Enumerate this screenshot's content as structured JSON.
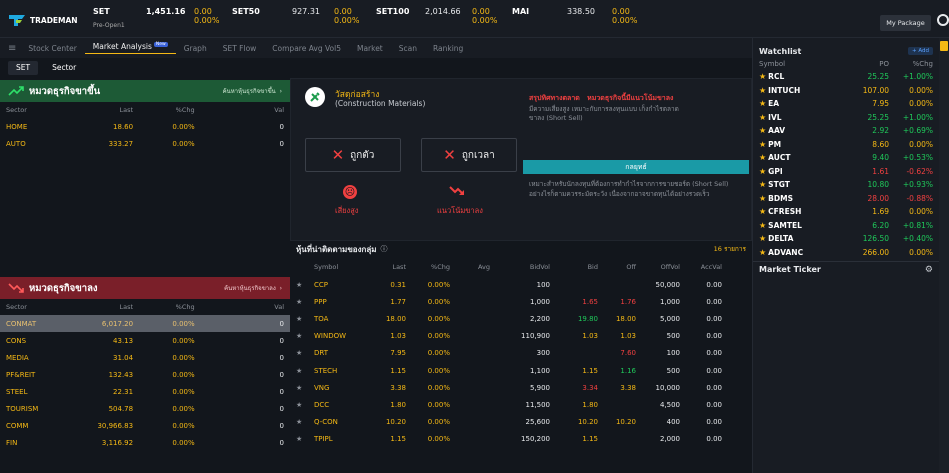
{
  "app": {
    "logo_text": "TRADEMAN",
    "my_package": "My Package"
  },
  "indices": [
    {
      "name": "SET",
      "value": "1,451.16",
      "chg": "0.00",
      "pct": "0.00%",
      "status": "Pre-Open1"
    },
    {
      "name": "SET50",
      "value": "927.31",
      "chg": "0.00",
      "pct": "0.00%"
    },
    {
      "name": "SET100",
      "value": "2,014.66",
      "chg": "0.00",
      "pct": "0.00%"
    },
    {
      "name": "MAI",
      "value": "338.50",
      "chg": "0.00",
      "pct": "0.00%"
    }
  ],
  "tabs": [
    "Stock Center",
    "Market Analysis",
    "Graph",
    "SET Flow",
    "Compare Avg Vol5",
    "Market",
    "Scan",
    "Ranking"
  ],
  "new_badge": "New",
  "subtabs": [
    "SET",
    "Sector"
  ],
  "up_panel": {
    "title": "หมวดธุรกิจขาขึ้น",
    "link": "ค้นหาหุ้นธุรกิจขาขึ้น",
    "headers": [
      "Sector",
      "Last",
      "%Chg",
      "Val"
    ],
    "rows": [
      [
        "HOME",
        "18.60",
        "0.00%",
        "0"
      ],
      [
        "AUTO",
        "333.27",
        "0.00%",
        "0"
      ]
    ]
  },
  "down_panel": {
    "title": "หมวดธุรกิจขาลง",
    "link": "ค้นหาหุ้นธุรกิจขาลง",
    "headers": [
      "Sector",
      "Last",
      "%Chg",
      "Val"
    ],
    "rows": [
      [
        "CONMAT",
        "6,017.20",
        "0.00%",
        "0"
      ],
      [
        "CONS",
        "43.13",
        "0.00%",
        "0"
      ],
      [
        "MEDIA",
        "31.04",
        "0.00%",
        "0"
      ],
      [
        "PF&REIT",
        "132.43",
        "0.00%",
        "0"
      ],
      [
        "STEEL",
        "22.31",
        "0.00%",
        "0"
      ],
      [
        "TOURISM",
        "504.78",
        "0.00%",
        "0"
      ],
      [
        "COMM",
        "30,966.83",
        "0.00%",
        "0"
      ],
      [
        "FIN",
        "3,116.92",
        "0.00%",
        "0"
      ]
    ]
  },
  "sector_card": {
    "name_th": "วัสดุก่อสร้าง",
    "name_en": "(Construction Materials)",
    "btn1": "ถูกตัว",
    "btn2": "ถูกเวลา",
    "risk": "เสี่ยงสูง",
    "trend": "แนวโน้มขาลง",
    "summary_title": "สรุปทิศทางตลาด",
    "summary_value": "หมวดธุรกิจนี้มีแนวโน้มขาลง",
    "summary_text": "มีความเสี่ยงสูง เหมาะกับการลงทุนแบบ เก็งกำไรตลาดขาลง (Short Sell)",
    "strategy_title": "กลยุทธ์",
    "strategy_text": "เหมาะสำหรับนักลงทุนที่ต้องการทำกำไรจากการขายชอร์ต (Short Sell) อย่างไรก็ตามควรระมัดระวัง เนื่องจากอาจขาดทุนได้อย่างรวดเร็ว"
  },
  "stock_table": {
    "title": "หุ้นที่น่าติดตามของกลุ่ม",
    "count": "16 รายการ",
    "headers": [
      "Symbol",
      "Last",
      "%Chg",
      "Avg",
      "BidVol",
      "Bid",
      "Off",
      "OffVol",
      "AccVal"
    ],
    "rows": [
      [
        "CCP",
        "0.31",
        "0.00%",
        "",
        "100",
        "",
        "",
        "50,000",
        "0.00"
      ],
      [
        "PPP",
        "1.77",
        "0.00%",
        "",
        "1,000",
        "1.65",
        "1.76",
        "1,000",
        "0.00"
      ],
      [
        "TOA",
        "18.00",
        "0.00%",
        "",
        "2,200",
        "19.80",
        "18.00",
        "5,000",
        "0.00"
      ],
      [
        "WINDOW",
        "1.03",
        "0.00%",
        "",
        "110,900",
        "1.03",
        "1.03",
        "500",
        "0.00"
      ],
      [
        "DRT",
        "7.95",
        "0.00%",
        "",
        "300",
        "",
        "7.60",
        "100",
        "0.00"
      ],
      [
        "STECH",
        "1.15",
        "0.00%",
        "",
        "1,100",
        "1.15",
        "1.16",
        "500",
        "0.00"
      ],
      [
        "VNG",
        "3.38",
        "0.00%",
        "",
        "5,900",
        "3.34",
        "3.38",
        "10,000",
        "0.00"
      ],
      [
        "DCC",
        "1.80",
        "0.00%",
        "",
        "11,500",
        "1.80",
        "",
        "4,500",
        "0.00"
      ],
      [
        "Q-CON",
        "10.20",
        "0.00%",
        "",
        "25,600",
        "10.20",
        "10.20",
        "400",
        "0.00"
      ],
      [
        "TPIPL",
        "1.15",
        "0.00%",
        "",
        "150,200",
        "1.15",
        "",
        "2,000",
        "0.00"
      ]
    ]
  },
  "watchlist": {
    "title": "Watchlist",
    "add": "+ Add",
    "headers": [
      "Symbol",
      "PO",
      "%Chg"
    ],
    "rows": [
      [
        "RCL",
        "25.25",
        "+1.00%",
        "g"
      ],
      [
        "INTUCH",
        "107.00",
        "0.00%",
        "y"
      ],
      [
        "EA",
        "7.95",
        "0.00%",
        "y"
      ],
      [
        "IVL",
        "25.25",
        "+1.00%",
        "g"
      ],
      [
        "AAV",
        "2.92",
        "+0.69%",
        "g"
      ],
      [
        "PM",
        "8.60",
        "0.00%",
        "y"
      ],
      [
        "AUCT",
        "9.40",
        "+0.53%",
        "g"
      ],
      [
        "GPI",
        "1.61",
        "-0.62%",
        "r"
      ],
      [
        "STGT",
        "10.80",
        "+0.93%",
        "g"
      ],
      [
        "BDMS",
        "28.00",
        "-0.88%",
        "r"
      ],
      [
        "CFRESH",
        "1.69",
        "0.00%",
        "y"
      ],
      [
        "SAMTEL",
        "6.20",
        "+0.81%",
        "g"
      ],
      [
        "DELTA",
        "126.50",
        "+0.40%",
        "g"
      ],
      [
        "ADVANC",
        "266.00",
        "0.00%",
        "y"
      ]
    ],
    "ticker": "Market Ticker"
  }
}
